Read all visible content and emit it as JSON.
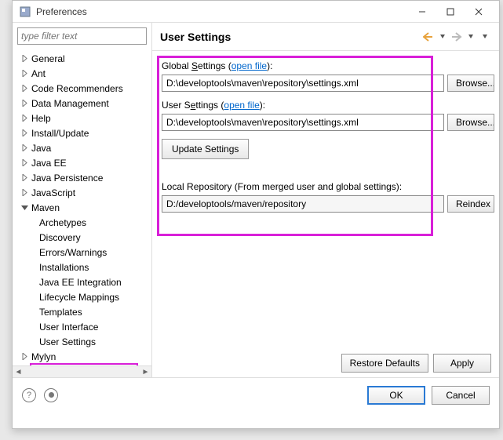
{
  "window": {
    "title": "Preferences"
  },
  "filter": {
    "placeholder": "type filter text"
  },
  "tree": {
    "items": [
      {
        "label": "General",
        "expand": "right"
      },
      {
        "label": "Ant",
        "expand": "right"
      },
      {
        "label": "Code Recommenders",
        "expand": "right"
      },
      {
        "label": "Data Management",
        "expand": "right"
      },
      {
        "label": "Help",
        "expand": "right"
      },
      {
        "label": "Install/Update",
        "expand": "right"
      },
      {
        "label": "Java",
        "expand": "right"
      },
      {
        "label": "Java EE",
        "expand": "right"
      },
      {
        "label": "Java Persistence",
        "expand": "right"
      },
      {
        "label": "JavaScript",
        "expand": "right"
      },
      {
        "label": "Maven",
        "expand": "down",
        "children": [
          {
            "label": "Archetypes"
          },
          {
            "label": "Discovery"
          },
          {
            "label": "Errors/Warnings"
          },
          {
            "label": "Installations"
          },
          {
            "label": "Java EE Integration"
          },
          {
            "label": "Lifecycle Mappings"
          },
          {
            "label": "Templates"
          },
          {
            "label": "User Interface"
          },
          {
            "label": "User Settings"
          }
        ]
      },
      {
        "label": "Mylyn",
        "expand": "right"
      }
    ]
  },
  "page": {
    "title": "User Settings",
    "global_label_pre": "Global",
    "global_label_u": "S",
    "global_label_post": "ettings (",
    "global_link": "open file",
    "global_label_end": "):",
    "global_value": "D:\\developtools\\maven\\repository\\settings.xml",
    "browse1": "Browse...",
    "user_label_pre": "User S",
    "user_label_u": "e",
    "user_label_post": "ttings (",
    "user_link": "open file",
    "user_label_end": "):",
    "user_value": "D:\\developtools\\maven\\repository\\settings.xml",
    "browse2": "Browse...",
    "update": "Update Settings",
    "local_label": "Local Repository (From merged user and global settings):",
    "local_value": "D:/developtools/maven/repository",
    "reindex": "Reindex",
    "restore": "Restore Defaults",
    "apply": "Apply"
  },
  "footer": {
    "ok": "OK",
    "cancel": "Cancel"
  }
}
